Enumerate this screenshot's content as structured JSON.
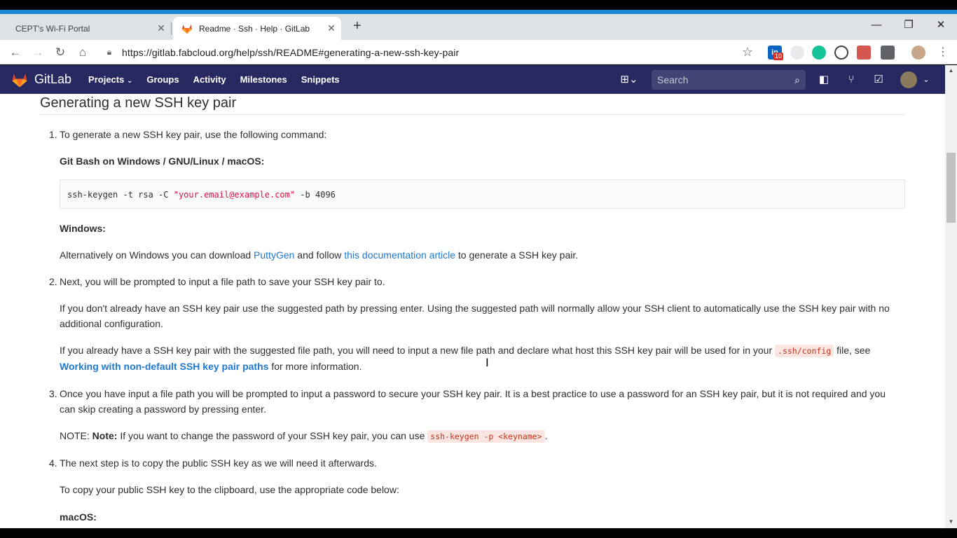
{
  "browser": {
    "tabs": [
      {
        "title": "CEPT's Wi-Fi Portal",
        "active": false
      },
      {
        "title": "Readme · Ssh · Help · GitLab",
        "active": true
      }
    ],
    "new_tab": "+",
    "url": "https://gitlab.fabcloud.org/help/ssh/README#generating-a-new-ssh-key-pair",
    "extension_badge": "10"
  },
  "gitlab": {
    "brand": "GitLab",
    "nav": [
      "Projects",
      "Groups",
      "Activity",
      "Milestones",
      "Snippets"
    ],
    "search_placeholder": "Search"
  },
  "doc": {
    "heading": "Generating a new SSH key pair",
    "step1_num": "1.",
    "step1": "To generate a new SSH key pair, use the following command:",
    "gitbash_label": "Git Bash on Windows / GNU/Linux / macOS:",
    "cmd_pre": "ssh-keygen -t rsa -C ",
    "cmd_str": "\"your.email@example.com\"",
    "cmd_post": " -b 4096",
    "windows_label": "Windows:",
    "windows_pre": "Alternatively on Windows you can download ",
    "puttygen_link": "PuttyGen",
    "windows_mid": " and follow ",
    "docs_link": "this documentation article",
    "windows_post": " to generate a SSH key pair.",
    "step2_num": "2.",
    "step2": "Next, you will be prompted to input a file path to save your SSH key pair to.",
    "step2_p1": "If you don't already have an SSH key pair use the suggested path by pressing enter. Using the suggested path will normally allow your SSH client to automatically use the SSH key pair with no additional configuration.",
    "step2_p2_pre": "If you already have a SSH key pair with the suggested file path, you will need to input a new file path and declare what host this SSH key pair will be used for in your ",
    "step2_p2_code": ".ssh/config",
    "step2_p2_mid": " file, see ",
    "step2_p2_link": "Working with non-default SSH key pair paths",
    "step2_p2_post": " for more information.",
    "step3_num": "3.",
    "step3": "Once you have input a file path you will be prompted to input a password to secure your SSH key pair. It is a best practice to use a password for an SSH key pair, but it is not required and you can skip creating a password by pressing enter.",
    "note_prefix": "NOTE: ",
    "note_bold": "Note:",
    "note_text": " If you want to change the password of your SSH key pair, you can use ",
    "note_code": "ssh-keygen -p <keyname>",
    "note_end": ".",
    "step4_num": "4.",
    "step4": "The next step is to copy the public SSH key as we will need it afterwards.",
    "step4_p1": "To copy your public SSH key to the clipboard, use the appropriate code below:",
    "macos_label": "macOS:"
  },
  "colors": {
    "gitlab_header": "#292961",
    "link": "#1f78d1",
    "window_border": "#1a87d5"
  }
}
